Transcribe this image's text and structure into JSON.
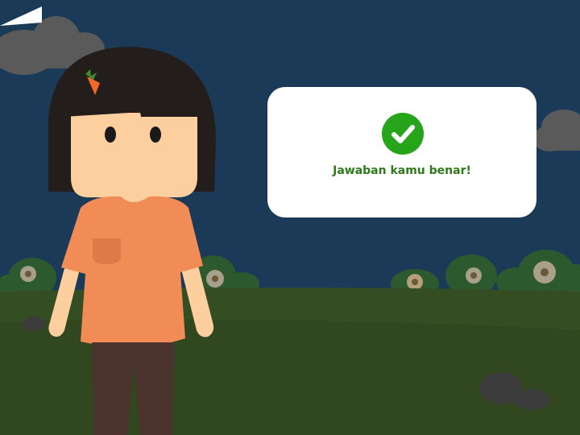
{
  "feedback": {
    "message": "Jawaban kamu benar!",
    "result": "correct",
    "icon": "checkmark-icon"
  },
  "colors": {
    "sky": "#1b3a57",
    "ground": "#344d22",
    "bubble": "#ffffff",
    "check": "#27a51a",
    "message_text": "#2f7a1c",
    "shirt": "#f28c57",
    "skin": "#fdcf9e",
    "hair": "#231d1b",
    "pants": "#4a342d"
  }
}
